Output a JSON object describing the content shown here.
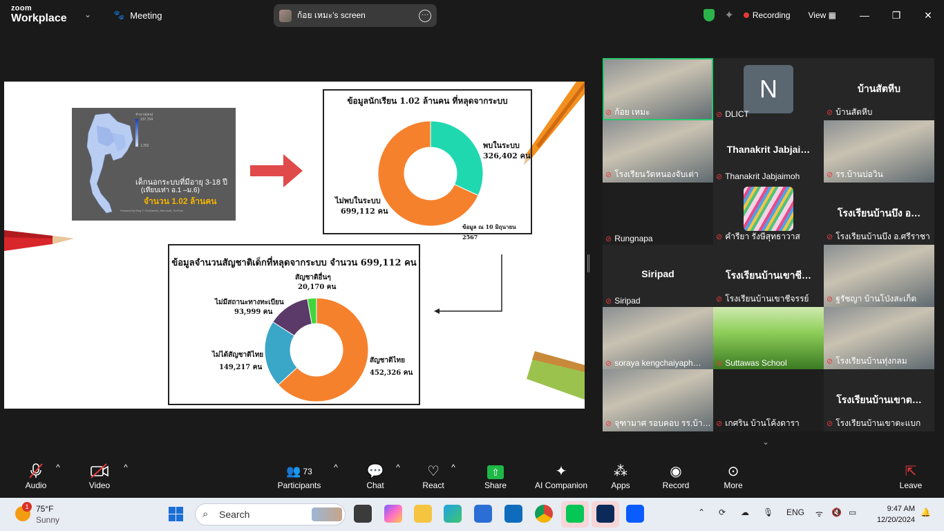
{
  "titlebar": {
    "logo_line1": "zoom",
    "logo_line2": "Workplace",
    "meeting_label": "Meeting",
    "share_label": "ก้อย เหมะ's screen",
    "recording_label": "Recording",
    "view_label": "View",
    "minimize": "—",
    "maximize": "❐",
    "close": "✕"
  },
  "slide": {
    "map_legend_title": "จำนวน(คน)",
    "map_legend_max": "137,704",
    "map_legend_min": "1,352",
    "map_caption_1": "เด็กนอกระบบที่มีอายุ 3-18 ปี",
    "map_caption_2": "(เทียบเท่า อ.1 –ม.6)",
    "map_caption_3": "จำนวน 1.02 ล้านคน",
    "map_credit": "Powered by Bing © GeoNames, Microsoft, TomTom",
    "chart1_title": "ข้อมูลนักเรียน 1.02 ล้านคน ที่หลุดจากระบบ",
    "chart1_found_label": "พบในระบบ",
    "chart1_found_value": "326,402 คน",
    "chart1_notfound_label": "ไม่พบในระบบ",
    "chart1_notfound_value": "699,112 คน",
    "chart1_note": "ข้อมูล ณ 10 มิถุนายน 2567",
    "chart2_title": "ข้อมูลจำนวนสัญชาติเด็กที่หลุดจากระบบ จำนวน 699,112 คน",
    "chart2_other_label": "สัญชาติอื่นๆ",
    "chart2_other_value": "20,170 คน",
    "chart2_nostatus_label": "ไม่มีสถานะทางทะเบียน",
    "chart2_nostatus_value": "93,999 คน",
    "chart2_nonthai_label": "ไม่ได้สัญชาติไทย",
    "chart2_nonthai_value": "149,217 คน",
    "chart2_thai_label": "สัญชาติไทย",
    "chart2_thai_value": "452,326 คน"
  },
  "chart_data": [
    {
      "type": "pie",
      "title": "ข้อมูลนักเรียน 1.02 ล้านคน ที่หลุดจากระบบ",
      "categories": [
        "พบในระบบ",
        "ไม่พบในระบบ"
      ],
      "values": [
        326402,
        699112
      ],
      "colors": [
        "#1fd8b0",
        "#f6812d"
      ],
      "donut": true
    },
    {
      "type": "pie",
      "title": "ข้อมูลจำนวนสัญชาติเด็กที่หลุดจากระบบ จำนวน 699,112 คน",
      "categories": [
        "สัญชาติไทย",
        "ไม่ได้สัญชาติไทย",
        "ไม่มีสถานะทางทะเบียน",
        "สัญชาติอื่นๆ"
      ],
      "values": [
        452326,
        149217,
        93999,
        20170
      ],
      "colors": [
        "#f6812d",
        "#3aa6c8",
        "#5b3968",
        "#41d63e"
      ],
      "donut": true
    }
  ],
  "gallery": [
    {
      "name": "ก้อย เหมะ",
      "big": "",
      "type": "video",
      "active": true
    },
    {
      "name": "DLICT",
      "big": "N",
      "type": "avatar"
    },
    {
      "name": "บ้านสัตหีบ",
      "big": "บ้านสัตหีบ",
      "type": "text"
    },
    {
      "name": "โรงเรียนวัดหนองจับเต่า",
      "big": "",
      "type": "video"
    },
    {
      "name": "Thanakrit Jabjaimoh",
      "big": "Thanakrit  Jabjai…",
      "type": "text"
    },
    {
      "name": "รร.บ้านบ่อวิน",
      "big": "",
      "type": "video"
    },
    {
      "name": "Rungnapa",
      "big": "",
      "type": "dark"
    },
    {
      "name": "คำรียา รังษีสุทธาวาส",
      "big": "",
      "type": "pencils"
    },
    {
      "name": "โรงเรียนบ้านบึง อ.ศรีราชา",
      "big": "โรงเรียนบ้านบึง อ…",
      "type": "text"
    },
    {
      "name": "Siripad",
      "big": "Siripad",
      "type": "text"
    },
    {
      "name": "โรงเรียนบ้านเขาชีจรรย์",
      "big": "โรงเรียนบ้านเขาชี…",
      "type": "text"
    },
    {
      "name": "ฐรัชญา บ้านโป่งสะเก็ต",
      "big": "",
      "type": "video"
    },
    {
      "name": "soraya kengchaiyaph…",
      "big": "",
      "type": "video"
    },
    {
      "name": "Suttawas School",
      "big": "",
      "type": "grass"
    },
    {
      "name": "โรงเรียนบ้านทุ่งกลม",
      "big": "",
      "type": "video"
    },
    {
      "name": "จุฑามาศ รอบคอบ รร.บ้า…",
      "big": "",
      "type": "video"
    },
    {
      "name": "เกศริน บ้านโค้งดารา",
      "big": "",
      "type": "dark"
    },
    {
      "name": "โรงเรียนบ้านเขาตะแบก",
      "big": "โรงเรียนบ้านเขาต…",
      "type": "text"
    }
  ],
  "toolbar": {
    "audio": "Audio",
    "video": "Video",
    "participants": "Participants",
    "participants_count": "73",
    "chat": "Chat",
    "react": "React",
    "share": "Share",
    "ai_companion": "AI Companion",
    "apps": "Apps",
    "record": "Record",
    "more": "More",
    "leave": "Leave"
  },
  "taskbar": {
    "weather_temp": "75°F",
    "weather_desc": "Sunny",
    "weather_badge": "1",
    "search_placeholder": "Search",
    "lang": "ENG",
    "time": "9:47 AM",
    "date": "12/20/2024"
  },
  "colors": {
    "accent_green": "#28c76f",
    "recording_red": "#e5393b",
    "share_green": "#1eb847"
  }
}
